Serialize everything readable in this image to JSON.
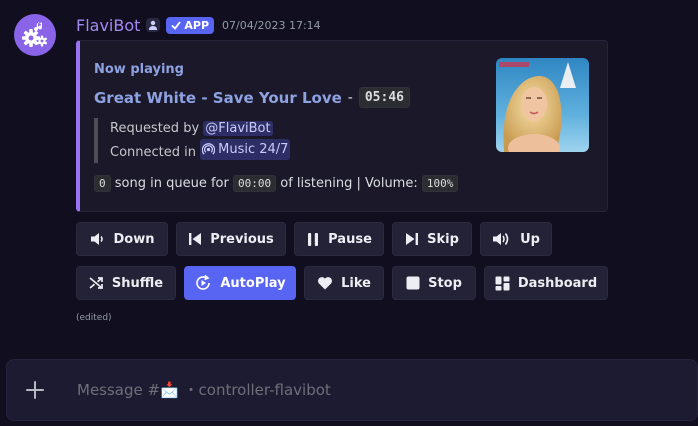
{
  "message": {
    "author": "FlaviBot",
    "app_badge": "APP",
    "timestamp": "07/04/2023 17:14",
    "edited_label": "(edited)"
  },
  "embed": {
    "accent_color": "#9a73f0",
    "heading": "Now playing",
    "track_title": "Great White - Save Your Love",
    "track_separator": "-",
    "track_duration": "05:46",
    "requested_by_label": "Requested by",
    "requested_by_user": "@FlaviBot",
    "connected_in_label": "Connected in",
    "connected_channel": "Music 24/7",
    "queue_count": "0",
    "queue_text": "song in queue for",
    "listening_time": "00:00",
    "listening_text": "of listening | Volume:",
    "volume": "100%"
  },
  "controls": {
    "row1": [
      {
        "id": "down",
        "label": "Down",
        "icon": "volume-down-icon"
      },
      {
        "id": "previous",
        "label": "Previous",
        "icon": "previous-track-icon"
      },
      {
        "id": "pause",
        "label": "Pause",
        "icon": "pause-icon"
      },
      {
        "id": "skip",
        "label": "Skip",
        "icon": "skip-track-icon"
      },
      {
        "id": "up",
        "label": "Up",
        "icon": "volume-up-icon"
      }
    ],
    "row2": [
      {
        "id": "shuffle",
        "label": "Shuffle",
        "icon": "shuffle-icon"
      },
      {
        "id": "autoplay",
        "label": "AutoPlay",
        "icon": "autoplay-icon",
        "active": true
      },
      {
        "id": "like",
        "label": "Like",
        "icon": "heart-icon"
      },
      {
        "id": "stop",
        "label": "Stop",
        "icon": "stop-icon"
      },
      {
        "id": "dashboard",
        "label": "Dashboard",
        "icon": "dashboard-icon"
      }
    ]
  },
  "composer": {
    "placeholder": "Message #📩 ・controller-flavibot"
  },
  "colors": {
    "background": "#100e1f",
    "username": "#a489f3",
    "link_blue": "#8ea1e1",
    "primary_button": "#5865f2",
    "secondary_button": "#232236"
  }
}
